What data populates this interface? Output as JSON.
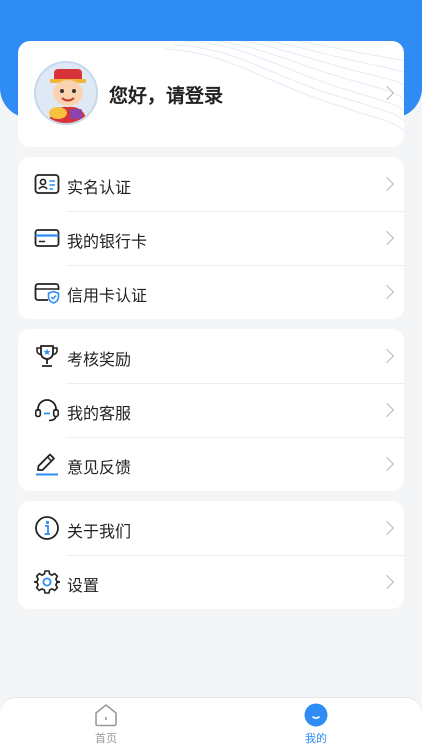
{
  "profile": {
    "greeting": "您好，请登录"
  },
  "menu_groups": [
    {
      "items": [
        {
          "label": "实名认证",
          "icon": "id-card-icon"
        },
        {
          "label": "我的银行卡",
          "icon": "bank-card-icon"
        },
        {
          "label": "信用卡认证",
          "icon": "credit-card-shield-icon"
        }
      ]
    },
    {
      "items": [
        {
          "label": "考核奖励",
          "icon": "trophy-icon"
        },
        {
          "label": "我的客服",
          "icon": "headset-icon"
        },
        {
          "label": "意见反馈",
          "icon": "pen-icon"
        }
      ]
    },
    {
      "items": [
        {
          "label": "关于我们",
          "icon": "info-icon"
        },
        {
          "label": "设置",
          "icon": "gear-icon"
        }
      ]
    }
  ],
  "tabbar": {
    "home": {
      "label": "首页",
      "icon": "home-icon"
    },
    "mine": {
      "label": "我的",
      "icon": "profile-tab-icon"
    }
  },
  "colors": {
    "accent": "#2f8cf5",
    "background": "#f4f5f7"
  }
}
